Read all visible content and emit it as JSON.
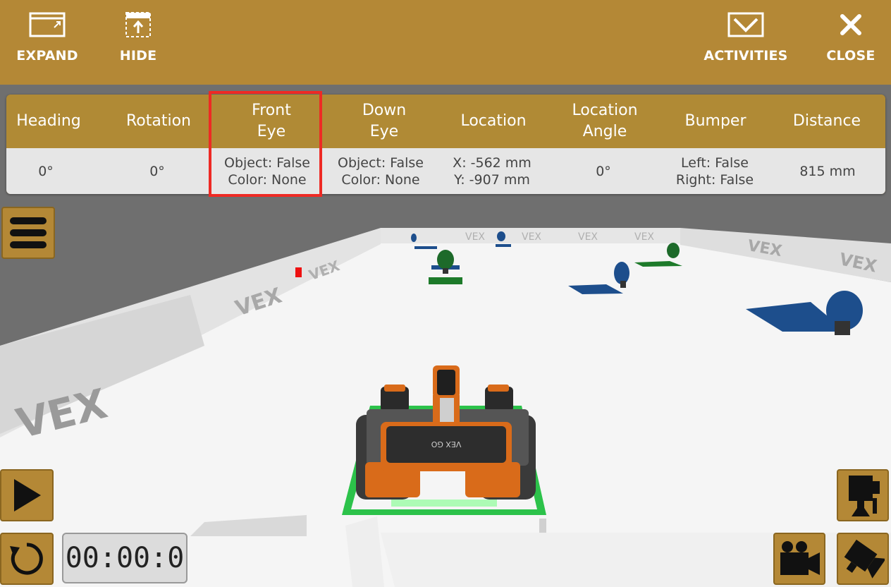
{
  "toolbar": {
    "expand_label": "EXPAND",
    "hide_label": "HIDE",
    "activities_label": "ACTIVITIES",
    "close_label": "CLOSE"
  },
  "telemetry": {
    "headers": {
      "heading": "Heading",
      "rotation": "Rotation",
      "front_eye": "Front\nEye",
      "down_eye": "Down\nEye",
      "location": "Location",
      "location_angle": "Location\nAngle",
      "bumper": "Bumper",
      "distance": "Distance"
    },
    "values": {
      "heading": "0°",
      "rotation": "0°",
      "front_eye": "Object: False\nColor: None",
      "down_eye": "Object: False\nColor: None",
      "location": "X: -562 mm\nY: -907 mm",
      "location_angle": "0°",
      "bumper": "Left: False\nRight: False",
      "distance": "815 mm"
    }
  },
  "scene": {
    "wall_logo": "VEX",
    "robot_label": "VEX GO"
  },
  "controls": {
    "timer": "00:00:0"
  },
  "colors": {
    "brand_gold": "#b48836",
    "highlight": "#ee2a24",
    "floor": "#f5f5f5",
    "robot_orange": "#d96b1a"
  },
  "icons": {
    "expand": "expand-window-icon",
    "hide": "hide-panel-icon",
    "activities": "activities-inbox-icon",
    "close": "close-x-icon",
    "menu": "hamburger-menu-icon",
    "play": "play-icon",
    "reset": "reset-icon",
    "camera_top": "top-camera-icon",
    "camera_follow": "follow-camera-icon",
    "camera_angle": "angled-camera-icon"
  }
}
